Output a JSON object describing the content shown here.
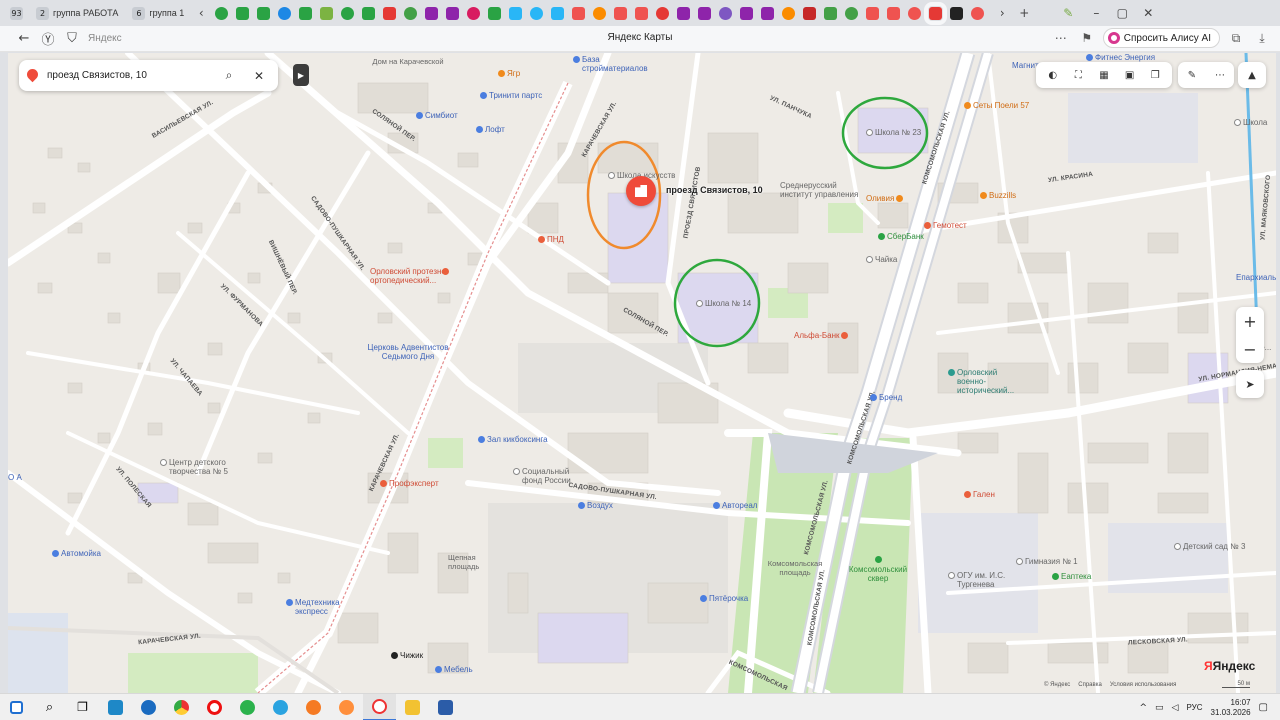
{
  "browser": {
    "tab_counters": [
      {
        "count": "93",
        "label": ""
      },
      {
        "count": "2",
        "label": "группа РАБОТА"
      },
      {
        "count": "6",
        "label": "группа 1"
      }
    ],
    "address_host": "Яндекс",
    "page_title": "Яндекс Карты",
    "alice_label": "Спросить Алису AI"
  },
  "search": {
    "value": "проезд Связистов, 10"
  },
  "target": {
    "label": "проезд Связистов, 10"
  },
  "map": {
    "streets": {
      "vasilevskaya": "ВАСИЛЬЕВСКАЯ УЛ.",
      "karachevskaya_top": "КАРАЧЕВСКАЯ УЛ.",
      "karachevskaya_mid": "КАРАЧЕВСКАЯ УЛ.",
      "karachevskaya_bottom": "КАРАЧЕВСКАЯ УЛ.",
      "solyanoy_top": "СОЛЯНОЙ ПЕР.",
      "solyanoy_mid": "СОЛЯНОЙ ПЕР.",
      "sadovo_pushkarnaya": "САДОВО-ПУШКАРНАЯ УЛ.",
      "sadovo_pushkarnaya_2": "САДОВО-ПУШКАРНАЯ УЛ.",
      "vishneviy": "ВИШНЁВЫЙ ПЕР.",
      "furmanova": "УЛ. ФУРМАНОВА",
      "chapaeva": "УЛ. ЧАПАЕВА",
      "komsomolskaya_1": "КОМСОМОЛЬСКАЯ УЛ.",
      "komsomolskaya_2": "КОМСОМОЛЬСКАЯ УЛ.",
      "komsomolskaya_3": "КОМСОМОЛЬСКАЯ УЛ.",
      "komsomolskaya_4": "КОМСОМОЛЬСКАЯ УЛ.",
      "komsomolskaya_5": "КОМСОМОЛЬСКАЯ",
      "krasina": "УЛ. КРАСИНА",
      "mayakovskogo": "УЛ. МАЯКОВСКОГО",
      "normandiya": "УЛ. НОРМАНДИЯ-НЕМАН",
      "leskova": "ЛЕСКОВСКАЯ УЛ.",
      "panchuka": "УЛ. ПАНЧУКА",
      "svyazistov": "ПРОЕЗД СВЯЗИСТОВ",
      "polesskaya": "УЛ. ПОЛЕСКАЯ"
    },
    "places": {
      "dom_karachevskoy": "Дом на Карачевской",
      "yagr": "Ягр",
      "baza": "База стройматериалов",
      "triniti": "Тринити партс",
      "simbiot": "Симбиот",
      "loft": "Лофт",
      "school_art": "Школа искусств",
      "pnd": "ПНД",
      "ortoped": "Орловский протезно-ортопедический...",
      "church": "Церковь Адвентистов Седьмого Дня",
      "kickbox": "Зал кикбоксинга",
      "social": "Социальный фонд России",
      "prof": "Профэксперт",
      "center": "Центр детского творчества № 5",
      "vozduh": "Воздух",
      "shelnaya": "Щепная площадь",
      "medtech": "Медтехника экспресс",
      "avtomoika": "Автомойка",
      "chizhik": "Чижик",
      "mebel": "Мебель",
      "pyaterochka": "Пятёрочка",
      "avtoreal": "Автореал",
      "komsomol_ploshad": "Комсомольская площадь",
      "komsomol_skver": "Комсомольский сквер",
      "school14": "Школа № 14",
      "school23": "Школа № 23",
      "srednerussky": "Среднерусский институт управления",
      "olivia": "Оливия",
      "sberbank": "СберБанк",
      "chayka": "Чайка",
      "alfa": "Альфа-Банк",
      "gemotest": "Гемотест",
      "buzzills": "Buzzills",
      "sushi": "Сеты Поели 57",
      "magnit": "Магнит",
      "fitness": "Фитнес Энергия",
      "brand": "Бренд",
      "orlovsky_museum": "Орловский военно-исторический...",
      "galen": "Гален",
      "gymnasium": "Гимназия № 1",
      "ogu": "ОГУ им. И.С. Тургенева",
      "eapteka": "Еаптека",
      "kindergarten": "Детский сад № 3",
      "eparchy": "Епархиальный...",
      "school_right": "Школа",
      "smolensk": "Смоле...",
      "left_edge": "О А"
    }
  },
  "credits": {
    "yandex": "© Яндекс",
    "reference": "Справка",
    "terms": "Условия использования",
    "scale": "50 м",
    "logo_black": "Яндекс",
    "logo_red": "Я"
  },
  "taskbar": {
    "lang": "РУС",
    "time": "16:07",
    "date": "31.03.2026"
  },
  "colors": {
    "accent": "#ef4b3a",
    "school_ring": "#2ea83d",
    "target_ring": "#f08a2d"
  }
}
